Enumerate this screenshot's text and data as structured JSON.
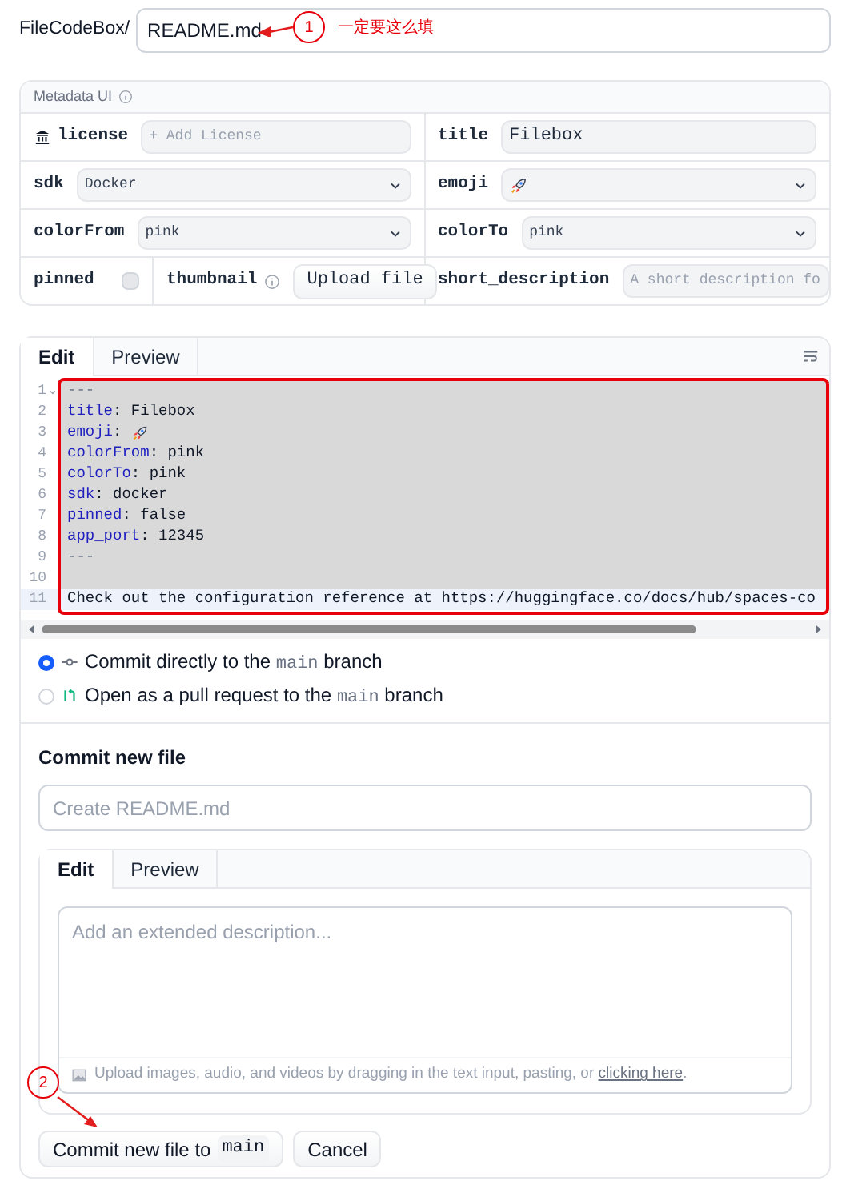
{
  "path": {
    "prefix": "FileCodeBox/",
    "filename": "README.md"
  },
  "annotations": [
    {
      "number": "1",
      "note": "一定要这么填"
    },
    {
      "number": "2"
    }
  ],
  "metadata": {
    "title": "Metadata UI",
    "rows": [
      {
        "left": [
          {
            "kind": "input",
            "label": "license",
            "placeholder": "+ Add License"
          }
        ],
        "right": [
          {
            "kind": "input",
            "label": "title",
            "value": "Filebox"
          }
        ]
      },
      {
        "left": [
          {
            "kind": "select",
            "label": "sdk",
            "value": "Docker"
          }
        ],
        "right": [
          {
            "kind": "select_icon",
            "label": "emoji"
          }
        ]
      },
      {
        "left": [
          {
            "kind": "select",
            "label": "colorFrom",
            "value": "pink"
          }
        ],
        "right": [
          {
            "kind": "select",
            "label": "colorTo",
            "value": "pink"
          }
        ]
      },
      {
        "left": [
          {
            "kind": "checkbox",
            "label": "pinned",
            "checked": false
          },
          {
            "kind": "upload",
            "label": "thumbnail",
            "button": "Upload file"
          }
        ],
        "right": [
          {
            "kind": "input",
            "label": "short_description",
            "placeholder": "A short description fo"
          }
        ]
      }
    ]
  },
  "editor": {
    "tabs": [
      {
        "label": "Edit",
        "selected": true
      },
      {
        "label": "Preview",
        "selected": false
      }
    ],
    "lines": [
      {
        "number": "1",
        "selected": true,
        "active": false,
        "foldable": true,
        "segments": [
          {
            "kind": "marker",
            "text": "---"
          }
        ]
      },
      {
        "number": "2",
        "selected": true,
        "active": false,
        "foldable": false,
        "segments": [
          {
            "kind": "key",
            "text": "title"
          },
          {
            "kind": "plain",
            "text": ": Filebox"
          }
        ]
      },
      {
        "number": "3",
        "selected": true,
        "active": false,
        "foldable": false,
        "segments": [
          {
            "kind": "key",
            "text": "emoji"
          },
          {
            "kind": "plain",
            "text": ":"
          },
          {
            "kind": "rocket"
          }
        ]
      },
      {
        "number": "4",
        "selected": true,
        "active": false,
        "foldable": false,
        "segments": [
          {
            "kind": "key",
            "text": "colorFrom"
          },
          {
            "kind": "plain",
            "text": ": pink"
          }
        ]
      },
      {
        "number": "5",
        "selected": true,
        "active": false,
        "foldable": false,
        "segments": [
          {
            "kind": "key",
            "text": "colorTo"
          },
          {
            "kind": "plain",
            "text": ": pink"
          }
        ]
      },
      {
        "number": "6",
        "selected": true,
        "active": false,
        "foldable": false,
        "segments": [
          {
            "kind": "key",
            "text": "sdk"
          },
          {
            "kind": "plain",
            "text": ": docker"
          }
        ]
      },
      {
        "number": "7",
        "selected": true,
        "active": false,
        "foldable": false,
        "segments": [
          {
            "kind": "key",
            "text": "pinned"
          },
          {
            "kind": "plain",
            "text": ": false"
          }
        ]
      },
      {
        "number": "8",
        "selected": true,
        "active": false,
        "foldable": false,
        "segments": [
          {
            "kind": "key",
            "text": "app_port"
          },
          {
            "kind": "plain",
            "text": ": 12345"
          }
        ]
      },
      {
        "number": "9",
        "selected": true,
        "active": false,
        "foldable": false,
        "segments": [
          {
            "kind": "marker",
            "text": "---"
          }
        ]
      },
      {
        "number": "10",
        "selected": true,
        "active": false,
        "foldable": false
      },
      {
        "number": "11",
        "selected": false,
        "active": true,
        "foldable": false,
        "segments": [
          {
            "kind": "plain",
            "text": "Check out the configuration reference at https://huggingface.co/docs/hub/spaces-co"
          }
        ]
      }
    ]
  },
  "commit_options": [
    {
      "kind": "direct",
      "before": "Commit directly to the",
      "branch": "main",
      "after": "branch",
      "selected": true
    },
    {
      "kind": "pull_request",
      "before": "Open as a pull request to the",
      "branch": "main",
      "after": "branch",
      "selected": false
    }
  ],
  "commit": {
    "heading": "Commit new file",
    "summary_placeholder": "Create README.md",
    "tabs": [
      {
        "label": "Edit",
        "selected": true
      },
      {
        "label": "Preview",
        "selected": false
      }
    ],
    "description_placeholder": "Add an extended description...",
    "upload_hint": "Upload images, audio, and videos by dragging in the text input, pasting, or",
    "upload_link": "clicking here",
    "upload_end": ".",
    "buttons": [
      {
        "label": "Commit new file to",
        "branch": "main"
      },
      {
        "label": "Cancel"
      }
    ]
  }
}
